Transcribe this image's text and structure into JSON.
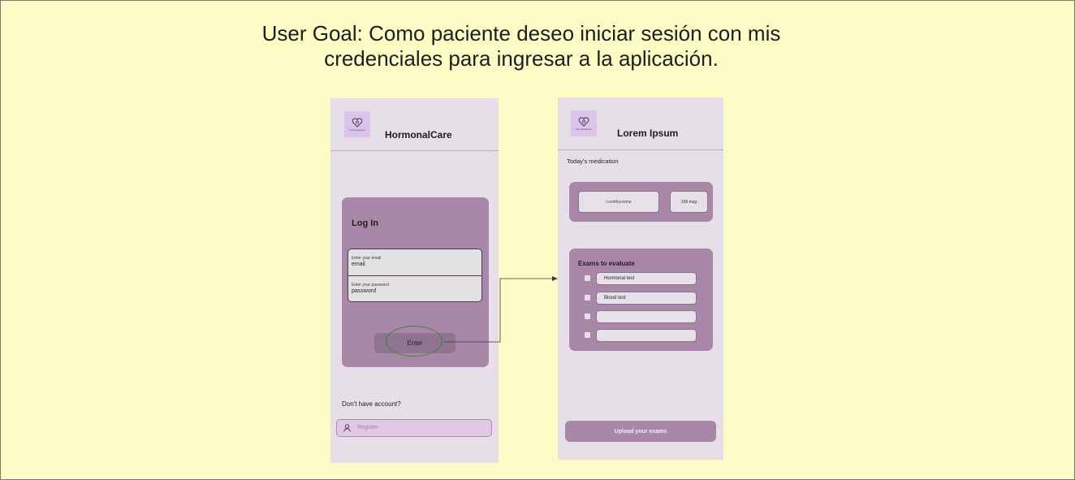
{
  "goal_text": "User Goal: Como paciente deseo iniciar sesión con mis credenciales para ingresar a la aplicación.",
  "login_screen": {
    "logo_text": "HormonalCare",
    "app_title": "HormonalCare",
    "card_title": "Log In",
    "email_label": "Enter your email",
    "email_value": "email",
    "password_label": "Enter your password",
    "password_value": "password",
    "enter_label": "Enter",
    "no_account_text": "Don't have account?",
    "register_label": "Register"
  },
  "home_screen": {
    "logo_text": "HormonalCare",
    "app_title": "Lorem Ipsum",
    "today_label": "Today's medication",
    "medication_name": "Levothyroxine",
    "medication_dose": "100 mcg",
    "exams_title": "Exams to evaluate",
    "exams": [
      "Hormonal test",
      "Blood test",
      "",
      ""
    ],
    "upload_label": "Upload your exams"
  },
  "colors": {
    "background": "#fdfcc7",
    "screen": "#e7dfe7",
    "card": "#a887a9",
    "highlight": "#2e8b2e"
  },
  "icons": [
    "heart-logo-icon",
    "user-icon",
    "arrow-icon"
  ]
}
